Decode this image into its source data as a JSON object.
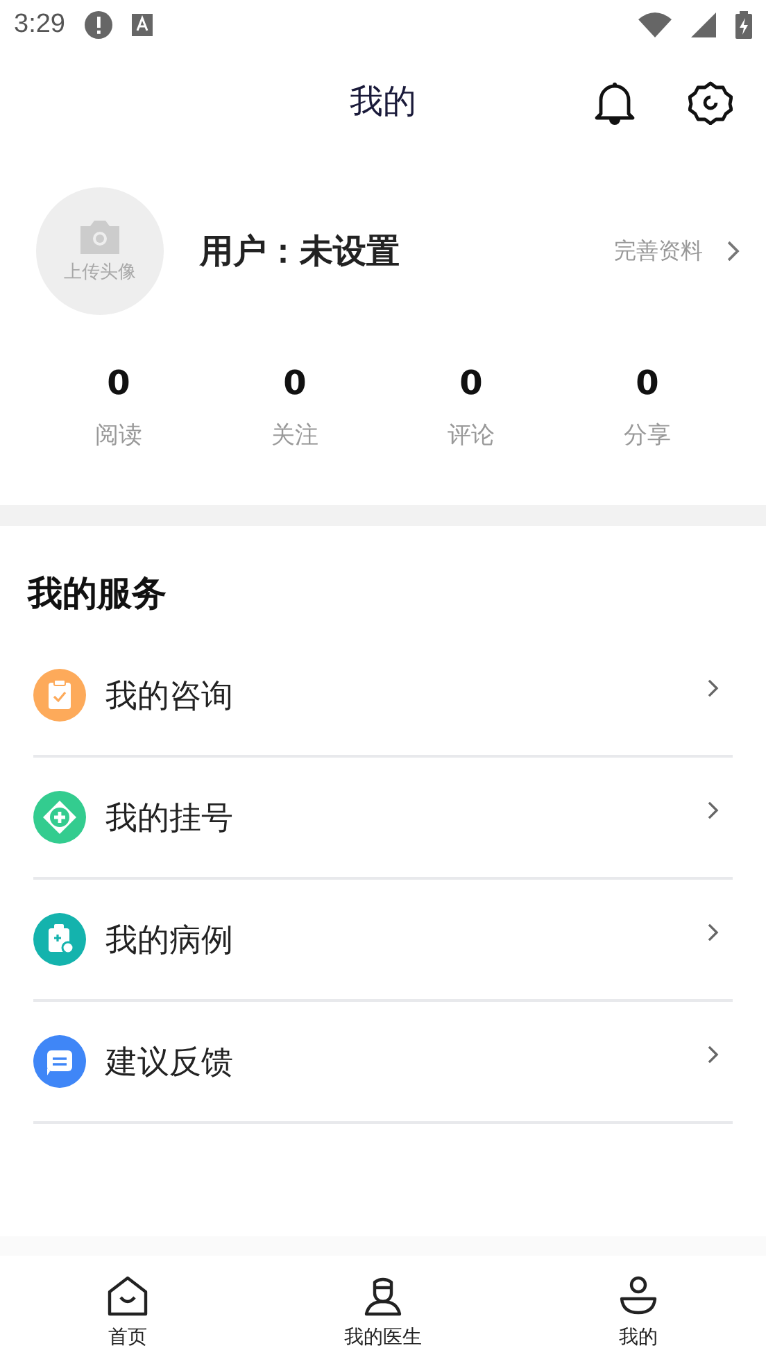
{
  "status_bar": {
    "time": "3:29"
  },
  "header": {
    "title": "我的"
  },
  "profile": {
    "avatar_label": "上传头像",
    "name": "用户：未设置",
    "edit_link": "完善资料"
  },
  "stats": [
    {
      "value": "0",
      "label": "阅读"
    },
    {
      "value": "0",
      "label": "关注"
    },
    {
      "value": "0",
      "label": "评论"
    },
    {
      "value": "0",
      "label": "分享"
    }
  ],
  "services": {
    "title": "我的服务",
    "items": [
      {
        "label": "我的咨询",
        "kind": "clipboard",
        "color": "#fdaa5a"
      },
      {
        "label": "我的挂号",
        "kind": "plus",
        "color": "#33cc8f"
      },
      {
        "label": "我的病例",
        "kind": "record",
        "color": "#14b3ad"
      },
      {
        "label": "建议反馈",
        "kind": "message",
        "color": "#3f86f7"
      }
    ]
  },
  "tab_bar": [
    {
      "label": "首页",
      "kind": "home"
    },
    {
      "label": "我的医生",
      "kind": "doctor"
    },
    {
      "label": "我的",
      "kind": "user"
    }
  ]
}
